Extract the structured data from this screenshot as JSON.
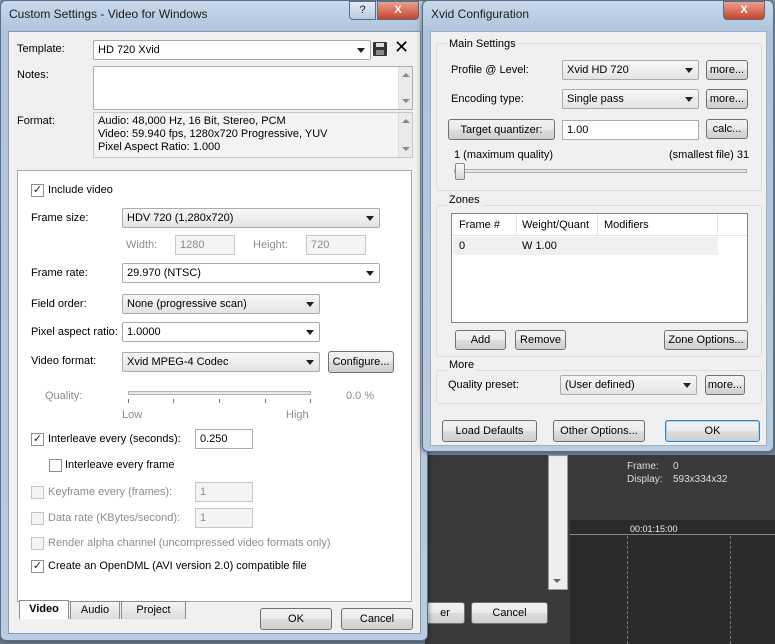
{
  "background": {
    "frame_label": "Frame:",
    "frame_value": "0",
    "display_label": "Display:",
    "display_value": "593x334x32",
    "timecode": "00:01:15:00",
    "partial_button": "er",
    "cancel_button": "Cancel"
  },
  "custom_settings": {
    "title": "Custom Settings - Video for Windows",
    "help_btn": "?",
    "close_btn": "X",
    "template_label": "Template:",
    "template_value": "HD 720 Xvid",
    "notes_label": "Notes:",
    "notes_value": "",
    "format_label": "Format:",
    "format_lines": [
      "Audio: 48,000 Hz, 16 Bit, Stereo, PCM",
      "Video: 59.940 fps, 1280x720 Progressive, YUV",
      "Pixel Aspect Ratio: 1.000"
    ],
    "include_video_label": "Include video",
    "frame_size_label": "Frame size:",
    "frame_size_value": "HDV 720 (1,280x720)",
    "width_label": "Width:",
    "width_value": "1280",
    "height_label": "Height:",
    "height_value": "720",
    "frame_rate_label": "Frame rate:",
    "frame_rate_value": "29.970 (NTSC)",
    "field_order_label": "Field order:",
    "field_order_value": "None (progressive scan)",
    "par_label": "Pixel aspect ratio:",
    "par_value": "1.0000",
    "video_format_label": "Video format:",
    "video_format_value": "Xvid MPEG-4 Codec",
    "configure_label": "Configure...",
    "quality_label": "Quality:",
    "quality_value": "0.0 %",
    "quality_low": "Low",
    "quality_high": "High",
    "interleave_label": "Interleave every (seconds):",
    "interleave_value": "0.250",
    "interleave_frame_label": "Interleave every frame",
    "keyframe_label": "Keyframe every (frames):",
    "keyframe_value": "1",
    "datarate_label": "Data rate (KBytes/second):",
    "datarate_value": "1",
    "alpha_label": "Render alpha channel (uncompressed video formats only)",
    "opendml_label": "Create an OpenDML (AVI version 2.0) compatible file",
    "tabs": [
      "Video",
      "Audio",
      "Project"
    ],
    "ok_label": "OK",
    "cancel_label": "Cancel"
  },
  "xvid": {
    "title": "Xvid Configuration",
    "close_btn": "X",
    "main_settings_label": "Main Settings",
    "profile_label": "Profile @ Level:",
    "profile_value": "Xvid HD 720",
    "more1": "more...",
    "encoding_label": "Encoding type:",
    "encoding_value": "Single pass",
    "more2": "more...",
    "target_quantizer_label": "Target quantizer:",
    "target_quantizer_value": "1.00",
    "calc_label": "calc...",
    "quality_min": "1 (maximum quality)",
    "quality_max": "(smallest file) 31",
    "zones_label": "Zones",
    "zones_headers": [
      "Frame #",
      "Weight/Quant",
      "Modifiers"
    ],
    "zones_row": [
      "0",
      "W 1.00",
      ""
    ],
    "add_label": "Add",
    "remove_label": "Remove",
    "zone_options_label": "Zone Options...",
    "more_label": "More",
    "quality_preset_label": "Quality preset:",
    "quality_preset_value": "(User defined)",
    "more3": "more...",
    "load_defaults_label": "Load Defaults",
    "other_options_label": "Other Options...",
    "ok_label": "OK"
  }
}
